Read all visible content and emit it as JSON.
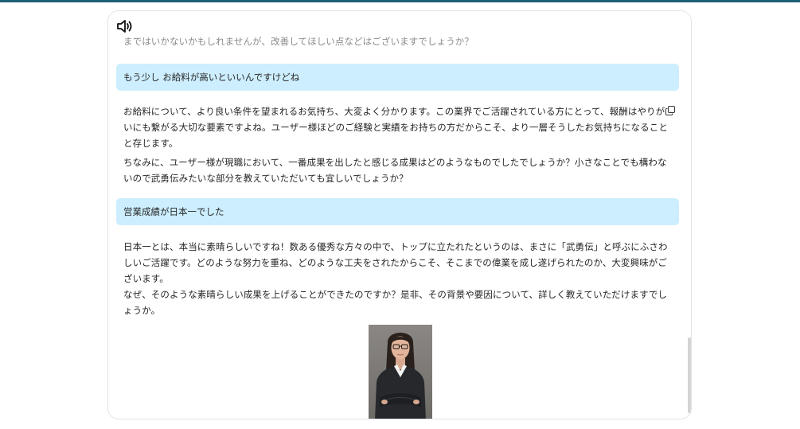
{
  "chat": {
    "partial_top_text": "まではいかないかもしれませんが、改善してほしい点などはございますでしょうか？",
    "messages": [
      {
        "role": "user",
        "text": "もう少し お給料が高いといいんですけどね"
      },
      {
        "role": "assistant",
        "paragraphs": [
          "お給料について、より良い条件を望まれるお気持ち、大変よく分かります。この業界でご活躍されている方にとって、報酬はやりがいにも繋がる大切な要素ですよね。ユーザー様ほどのご経験と実績をお持ちの方だからこそ、より一層そうしたお気持ちになることと存じます。",
          "ちなみに、ユーザー様が現職において、一番成果を出したと感じる成果はどのようなものでしたでしょうか？小さなことでも構わないので武勇伝みたいな部分を教えていただいても宜しいでしょうか？"
        ]
      },
      {
        "role": "user",
        "text": "営業成績が日本一でした"
      },
      {
        "role": "assistant",
        "paragraphs": [
          "日本一とは、本当に素晴らしいですね！数ある優秀な方々の中で、トップに立たれたというのは、まさに「武勇伝」と呼ぶにふさわしいご活躍です。どのような努力を重ね、どのような工夫をされたからこそ、そこまでの偉業を成し遂げられたのか、大変興味がございます。\nなぜ、そのような素晴らしい成果を上げることができたのですか？是非、その背景や要因について、詳しく教えていただけますでしょうか。"
        ]
      }
    ]
  },
  "icons": {
    "speaker": "speaker-icon",
    "copy": "copy-icon"
  },
  "colors": {
    "top_accent": "#1e5f74",
    "user_bubble": "#cdeefe",
    "panel_border": "#dfe3ea"
  }
}
